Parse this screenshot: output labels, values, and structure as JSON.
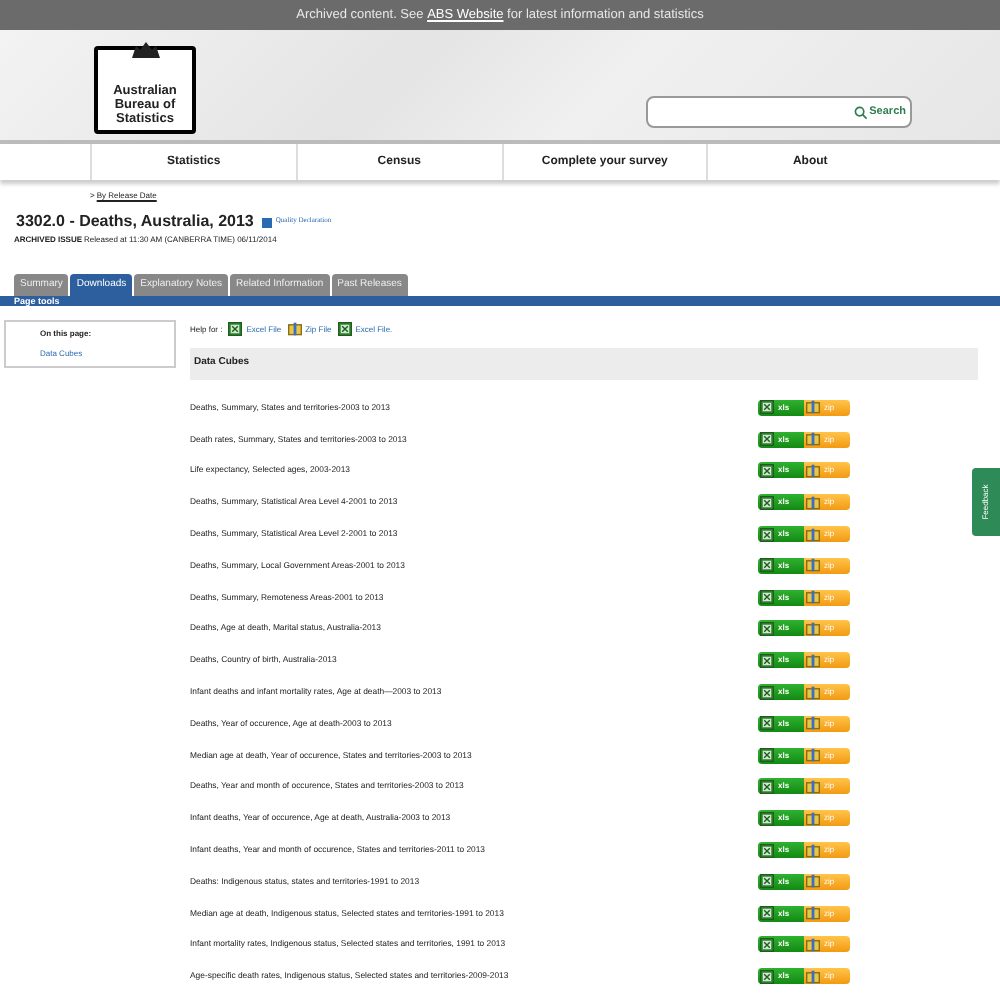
{
  "banner": {
    "before": "Archived content. See ",
    "link": "ABS Website",
    "after": " for latest information and statistics"
  },
  "logo": {
    "lines": [
      "Australian",
      "Bureau of",
      "Statistics"
    ]
  },
  "search": {
    "button": "Search"
  },
  "nav": [
    "Statistics",
    "Census",
    "Complete your survey",
    "About"
  ],
  "breadcrumb": {
    "prefix": ">",
    "link": "By Release Date"
  },
  "title": "3302.0 - Deaths, Australia, 2013",
  "quality_link": "Quality Declaration",
  "issue": {
    "label": "ARCHIVED ISSUE",
    "text": "Released at 11:30 AM (CANBERRA TIME) 06/11/2014"
  },
  "tabs": [
    {
      "label": "Summary",
      "selected": false
    },
    {
      "label": "Downloads",
      "selected": true
    },
    {
      "label": "Explanatory Notes",
      "selected": false
    },
    {
      "label": "Related Information",
      "selected": false
    },
    {
      "label": "Past Releases",
      "selected": false
    }
  ],
  "page_tools": "Page tools",
  "sidebar": {
    "title": "On this page:",
    "links": [
      "Data Cubes"
    ]
  },
  "help": {
    "label": "Help for :",
    "links": [
      {
        "kind": "excel",
        "label": "Excel File"
      },
      {
        "kind": "zip",
        "label": "Zip File"
      },
      {
        "kind": "excel",
        "label": "Excel File."
      }
    ]
  },
  "section_title": "Data Cubes",
  "cubes": [
    {
      "label": "Deaths, Summary, States and territories-2003 to 2013",
      "xls": "xls",
      "zip": "zip"
    },
    {
      "label": "Death rates, Summary, States and territories-2003 to 2013",
      "xls": "xls",
      "zip": "zip"
    },
    {
      "label": "Life expectancy, Selected ages, 2003-2013",
      "xls": "xls",
      "zip": "zip"
    },
    {
      "label": "Deaths, Summary, Statistical Area Level 4-2001 to 2013",
      "xls": "xls",
      "zip": "zip"
    },
    {
      "label": "Deaths, Summary, Statistical Area Level 2-2001 to 2013",
      "xls": "xls",
      "zip": "zip"
    },
    {
      "label": "Deaths, Summary, Local Government Areas-2001 to 2013",
      "xls": "xls",
      "zip": "zip"
    },
    {
      "label": "Deaths, Summary, Remoteness Areas-2001 to 2013",
      "xls": "xls",
      "zip": "zip"
    },
    {
      "label": "Deaths, Age at death, Marital status, Australia-2013",
      "xls": "xls",
      "zip": "zip"
    },
    {
      "label": "Deaths, Country of birth, Australia-2013",
      "xls": "xls",
      "zip": "zip"
    },
    {
      "label": "Infant deaths and infant mortality rates, Age at death—2003 to 2013",
      "xls": "xls",
      "zip": "zip"
    },
    {
      "label": "Deaths, Year of occurence, Age at death-2003 to 2013",
      "xls": "xls",
      "zip": "zip"
    },
    {
      "label": "Median age at death, Year of occurence, States and territories-2003 to 2013",
      "xls": "xls",
      "zip": "zip"
    },
    {
      "label": "Deaths, Year and month of occurence, States and territories-2003 to 2013",
      "xls": "xls",
      "zip": "zip"
    },
    {
      "label": "Infant deaths, Year of occurence, Age at death, Australia-2003 to 2013",
      "xls": "xls",
      "zip": "zip"
    },
    {
      "label": "Infant deaths, Year and month of occurence, States and territories-2011 to 2013",
      "xls": "xls",
      "zip": "zip"
    },
    {
      "label": "Deaths: Indigenous status, states and territories-1991 to 2013",
      "xls": "xls",
      "zip": "zip"
    },
    {
      "label": "Median age at death, Indigenous status, Selected states and territories-1991 to 2013",
      "xls": "xls",
      "zip": "zip"
    },
    {
      "label": "Infant mortality rates, Indigenous status, Selected states and territories, 1991 to 2013",
      "xls": "xls",
      "zip": "zip"
    },
    {
      "label": "Age-specific death rates, Indigenous status, Selected states and territories-2009-2013",
      "xls": "xls",
      "zip": "zip"
    }
  ],
  "feedback": "Feedback"
}
